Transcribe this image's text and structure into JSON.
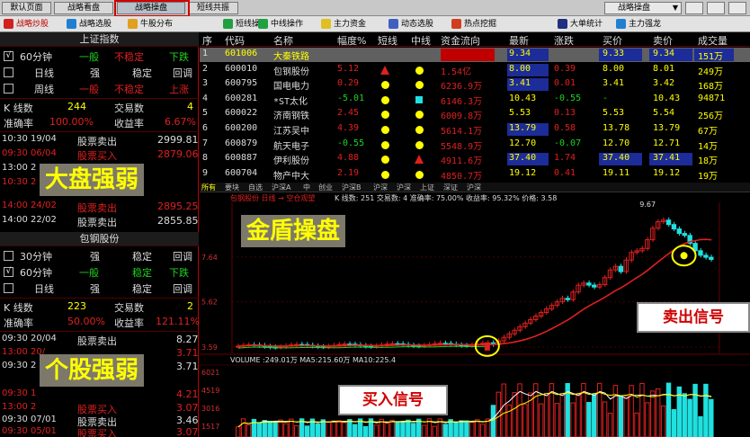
{
  "top_tabs": [
    "默认页面",
    "战略看盘",
    "战略操盘",
    "短线共振"
  ],
  "top_right_select": "战略操盘",
  "toolbar": [
    "战略炒股",
    "战略选股",
    "牛股分布",
    "短线操作",
    "中线操作",
    "主力资金",
    "动态选股",
    "热点挖掘",
    "大单统计",
    "主力强龙"
  ],
  "left": {
    "index_title": "上证指数",
    "stock_title": "包钢股份",
    "index_rows": [
      {
        "check": "√",
        "p": "60分钟",
        "a": "一般",
        "b": "不稳定",
        "c": "下跌"
      },
      {
        "check": "",
        "p": "日线",
        "a": "强",
        "b": "稳定",
        "c": "回调"
      },
      {
        "check": "",
        "p": "周线",
        "a": "一般",
        "b": "不稳定",
        "c": "上涨"
      }
    ],
    "index_k_label": "K 线数",
    "index_k": "244",
    "index_trades_label": "交易数",
    "index_trades": "4",
    "index_acc_label": "准确率",
    "index_acc": "100.00%",
    "index_profit_label": "收益率",
    "index_profit": "6.67%",
    "index_trades_list": [
      {
        "time": "10:30 19/04",
        "action": "股票卖出",
        "price": "2999.81"
      },
      {
        "time": "09:30 06/04",
        "action": "股票买入",
        "price": "2879.06"
      },
      {
        "time": "13:00 2",
        "action": "",
        "price": ""
      },
      {
        "time": "10:30 2",
        "action": "",
        "price": ""
      },
      {
        "time": "14:00 24/02",
        "action": "股票卖出",
        "price": "2895.25"
      },
      {
        "time": "14:00 22/02",
        "action": "股票卖出",
        "price": "2855.85"
      }
    ],
    "stock_rows": [
      {
        "check": "",
        "p": "30分钟",
        "a": "强",
        "b": "稳定",
        "c": "回调"
      },
      {
        "check": "√",
        "p": "60分钟",
        "a": "一般",
        "b": "稳定",
        "c": "下跌"
      },
      {
        "check": "",
        "p": "日线",
        "a": "强",
        "b": "稳定",
        "c": "回调"
      }
    ],
    "stock_k_label": "K 线数",
    "stock_k": "223",
    "stock_trades_label": "交易数",
    "stock_trades": "2",
    "stock_acc_label": "准确率",
    "stock_acc": "50.00%",
    "stock_profit_label": "收益率",
    "stock_profit": "121.11%",
    "stock_trades_list": [
      {
        "time": "09:30 20/04",
        "action": "股票卖出",
        "price": "8.27"
      },
      {
        "time": "13:00 20/",
        "action": "",
        "price": "3.71"
      },
      {
        "time": "09:30 2",
        "action": "",
        "price": "3.71"
      },
      {
        "time": "09:30 1",
        "action": "",
        "price": "4.21"
      },
      {
        "time": "13:00 2",
        "action": "股票买入",
        "price": "3.07"
      },
      {
        "time": "09:30 07/01",
        "action": "股票卖出",
        "price": "3.46"
      },
      {
        "time": "09:30 05/01",
        "action": "股票买入",
        "price": "3.07"
      }
    ],
    "overlay_market": "大盘强弱",
    "overlay_stock": "个股强弱"
  },
  "table": {
    "headers": [
      "序",
      "代码",
      "名称",
      "幅度%",
      "短线",
      "中线",
      "资金流向",
      "最新",
      "涨跌",
      "买价",
      "卖价",
      "成交量"
    ],
    "rows": [
      [
        "1",
        "601006",
        "大秦铁路",
        "",
        "",
        "",
        "",
        "9.34",
        "",
        "9.33",
        "9.34",
        "151万"
      ],
      [
        "2",
        "600010",
        "包钢股份",
        "5.12",
        "tri",
        "dot",
        "1.54亿",
        "8.00",
        "0.39",
        "8.00",
        "8.01",
        "249万"
      ],
      [
        "3",
        "600795",
        "国电电力",
        "0.29",
        "dot",
        "dot",
        "6236.9万",
        "3.41",
        "0.01",
        "3.41",
        "3.42",
        "168万"
      ],
      [
        "4",
        "600281",
        "*ST太化",
        "-5.01",
        "dot",
        "sq",
        "6146.3万",
        "10.43",
        "-0.55",
        "-",
        "10.43",
        "94871"
      ],
      [
        "5",
        "600022",
        "济南钢铁",
        "2.45",
        "dot",
        "dot",
        "6009.8万",
        "5.53",
        "0.13",
        "5.53",
        "5.54",
        "256万"
      ],
      [
        "6",
        "600200",
        "江苏吴中",
        "4.39",
        "dot",
        "dot",
        "5614.1万",
        "13.79",
        "0.58",
        "13.78",
        "13.79",
        "67万"
      ],
      [
        "7",
        "600879",
        "航天电子",
        "-0.55",
        "dot",
        "dot",
        "5548.9万",
        "12.70",
        "-0.07",
        "12.70",
        "12.71",
        "14万"
      ],
      [
        "8",
        "600887",
        "伊利股份",
        "4.88",
        "dot",
        "tri",
        "4911.6万",
        "37.40",
        "1.74",
        "37.40",
        "37.41",
        "18万"
      ],
      [
        "9",
        "600704",
        "物产中大",
        "2.19",
        "dot",
        "dot",
        "4850.7万",
        "19.12",
        "0.41",
        "19.11",
        "19.12",
        "19万"
      ]
    ]
  },
  "chart": {
    "tabs": [
      "所有",
      "要块",
      "自选",
      "沪深A",
      "中",
      "创业",
      "沪深B",
      "沪深",
      "沪深",
      "上证",
      "深证",
      "沪深"
    ],
    "info_name": "包钢股份 日线 → 空仓观望",
    "info_k": "K 线数: 251 交易数: 4 准确率: 75.00% 收益率: 95.32% 价格: 3.58",
    "overlay_title": "金盾操盘",
    "buy_signal": "买入信号",
    "sell_signal": "卖出信号",
    "price_high": "9.67",
    "y_labels": [
      "7.64",
      "5.62",
      "3.59"
    ],
    "volume_text": "VOLUME :249.01万 MA5:215.60万 MA10:225.4",
    "vol_labels": [
      "6021",
      "4519",
      "3016",
      "1517"
    ]
  },
  "colors": {
    "up": "#e02020",
    "down": "#20e0e0",
    "ma": "#e02020",
    "yellow": "#ffff00",
    "highlight": "#1c2c98",
    "sell": "#e02020",
    "buy": "#20d020"
  }
}
